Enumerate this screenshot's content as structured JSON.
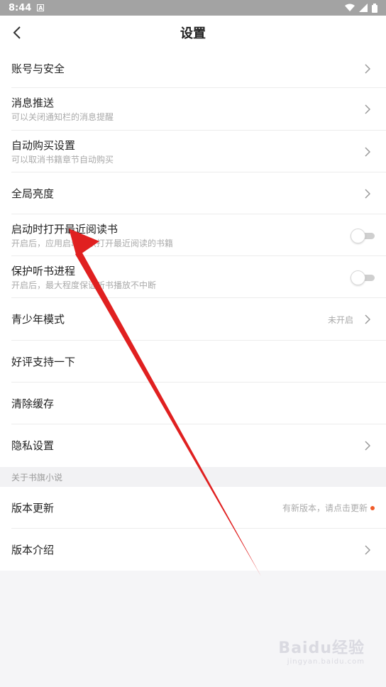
{
  "status": {
    "time": "8:44",
    "notif": "A"
  },
  "header": {
    "title": "设置"
  },
  "items": [
    {
      "label": "账号与安全"
    },
    {
      "label": "消息推送",
      "sub": "可以关闭通知栏的消息提醒"
    },
    {
      "label": "自动购买设置",
      "sub": "可以取消书籍章节自动购买"
    },
    {
      "label": "全局亮度"
    },
    {
      "label": "启动时打开最近阅读书",
      "sub": "开启后，应用启动默认打开最近阅读的书籍"
    },
    {
      "label": "保护听书进程",
      "sub": "开启后，最大程度保证听书播放不中断"
    },
    {
      "label": "青少年模式",
      "value": "未开启"
    },
    {
      "label": "好评支持一下"
    },
    {
      "label": "清除缓存"
    },
    {
      "label": "隐私设置"
    }
  ],
  "section": {
    "title": "关于书旗小说"
  },
  "about": [
    {
      "label": "版本更新",
      "value": "有新版本，请点击更新"
    },
    {
      "label": "版本介绍"
    }
  ],
  "watermark": {
    "text": "Baidu经验",
    "sub": "jingyan.baidu.com"
  },
  "colors": {
    "accent": "#f05a28",
    "arrow": "#e02020"
  }
}
